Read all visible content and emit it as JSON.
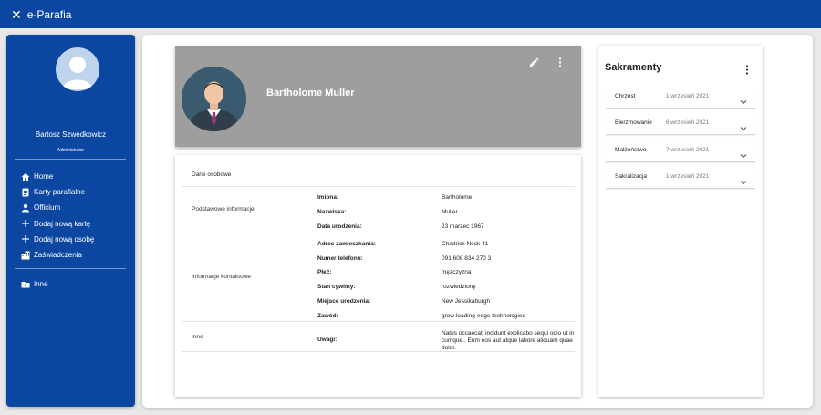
{
  "app": {
    "title": "e-Parafia"
  },
  "sidebar": {
    "user_name": "Bartosz Szwedkowicz",
    "user_role": "Administrator",
    "nav": [
      {
        "label": "Home",
        "icon": "home-icon"
      },
      {
        "label": "Karty parafialne",
        "icon": "document-icon"
      },
      {
        "label": "Officium",
        "icon": "person-icon"
      },
      {
        "label": "Dodaj nową kartę",
        "icon": "plus-icon"
      },
      {
        "label": "Dodaj nową osobę",
        "icon": "plus-icon"
      },
      {
        "label": "Zaświadczenia",
        "icon": "building-icon"
      }
    ],
    "other": {
      "label": "Inne",
      "icon": "folder-icon"
    }
  },
  "profile": {
    "name": "Bartholome Muller"
  },
  "details": {
    "section_title": "Dane osobowe",
    "groups": [
      {
        "label": "Podstawowe informacje",
        "rows": [
          {
            "key": "Imiona:",
            "value": "Bartholome"
          },
          {
            "key": "Nazwiska:",
            "value": "Muller"
          },
          {
            "key": "Data urodzenia:",
            "value": "23 marzec 1967"
          }
        ]
      },
      {
        "label": "Informacje kontaktowe",
        "rows": [
          {
            "key": "Adres zamieszkania:",
            "value": "Chadrick Neck 41"
          },
          {
            "key": "Numer telefonu:",
            "value": "091 608 834 270 3"
          },
          {
            "key": "Płeć:",
            "value": "mężczyzna"
          },
          {
            "key": "Stan cywilny:",
            "value": "rozwiedziony"
          },
          {
            "key": "Miejsce urodzenia:",
            "value": "New Jessikaburgh"
          },
          {
            "key": "Zawód:",
            "value": "grow leading-edge technologies"
          }
        ]
      },
      {
        "label": "Inne",
        "rows": [
          {
            "key": "Uwagi:",
            "value": "Natus occaecati incidunt explicabo sequi odio ut in cumque.. Eum eos aut atque labore aliquam quae dolor."
          }
        ]
      }
    ]
  },
  "sakramenty": {
    "title": "Sakramenty",
    "items": [
      {
        "name": "Chrzest",
        "date": "1 wrzesień 2021"
      },
      {
        "name": "Bierzmowanie",
        "date": "6 wrzesień 2021"
      },
      {
        "name": "Małżeństwo",
        "date": "7 wrzesień 2021"
      },
      {
        "name": "Sakralizacja",
        "date": "1 wrzesień 2021"
      }
    ]
  },
  "colors": {
    "primary": "#0b47a1",
    "hero_bg": "#9e9e9e",
    "page_bg": "#e9e9e9"
  }
}
